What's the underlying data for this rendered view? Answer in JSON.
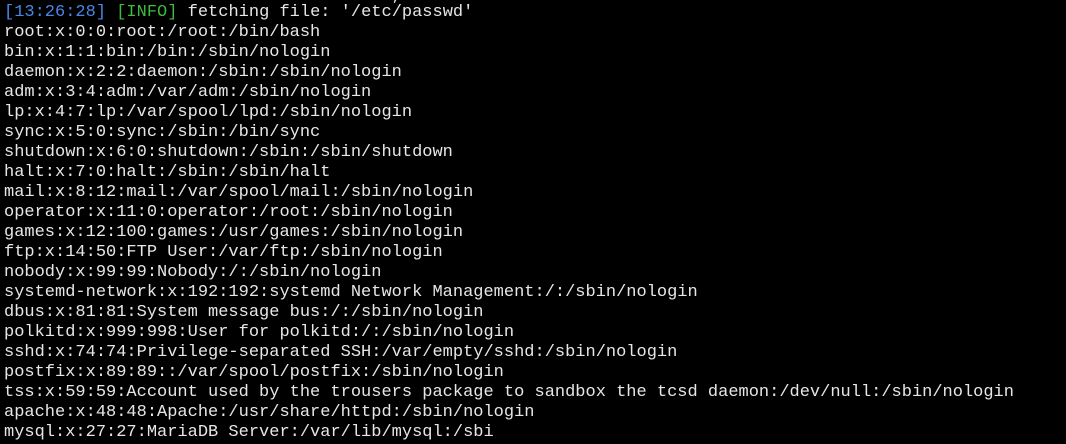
{
  "colors": {
    "background": "#000000",
    "foreground": "#e6e6e6",
    "timestamp": "#4a86e8",
    "info": "#3dbb3d"
  },
  "top_fragment": "                                 ' ·  ,  '",
  "log": {
    "timestamp": "[13:26:28]",
    "level": "[INFO]",
    "message": " fetching file: '/etc/passwd'"
  },
  "output_lines": [
    "root:x:0:0:root:/root:/bin/bash",
    "bin:x:1:1:bin:/bin:/sbin/nologin",
    "daemon:x:2:2:daemon:/sbin:/sbin/nologin",
    "adm:x:3:4:adm:/var/adm:/sbin/nologin",
    "lp:x:4:7:lp:/var/spool/lpd:/sbin/nologin",
    "sync:x:5:0:sync:/sbin:/bin/sync",
    "shutdown:x:6:0:shutdown:/sbin:/sbin/shutdown",
    "halt:x:7:0:halt:/sbin:/sbin/halt",
    "mail:x:8:12:mail:/var/spool/mail:/sbin/nologin",
    "operator:x:11:0:operator:/root:/sbin/nologin",
    "games:x:12:100:games:/usr/games:/sbin/nologin",
    "ftp:x:14:50:FTP User:/var/ftp:/sbin/nologin",
    "nobody:x:99:99:Nobody:/:/sbin/nologin",
    "systemd-network:x:192:192:systemd Network Management:/:/sbin/nologin",
    "dbus:x:81:81:System message bus:/:/sbin/nologin",
    "polkitd:x:999:998:User for polkitd:/:/sbin/nologin",
    "sshd:x:74:74:Privilege-separated SSH:/var/empty/sshd:/sbin/nologin",
    "postfix:x:89:89::/var/spool/postfix:/sbin/nologin",
    "tss:x:59:59:Account used by the trousers package to sandbox the tcsd daemon:/dev/null:/sbin/nologin",
    "apache:x:48:48:Apache:/usr/share/httpd:/sbin/nologin",
    "mysql:x:27:27:MariaDB Server:/var/lib/mysql:/sbi"
  ]
}
